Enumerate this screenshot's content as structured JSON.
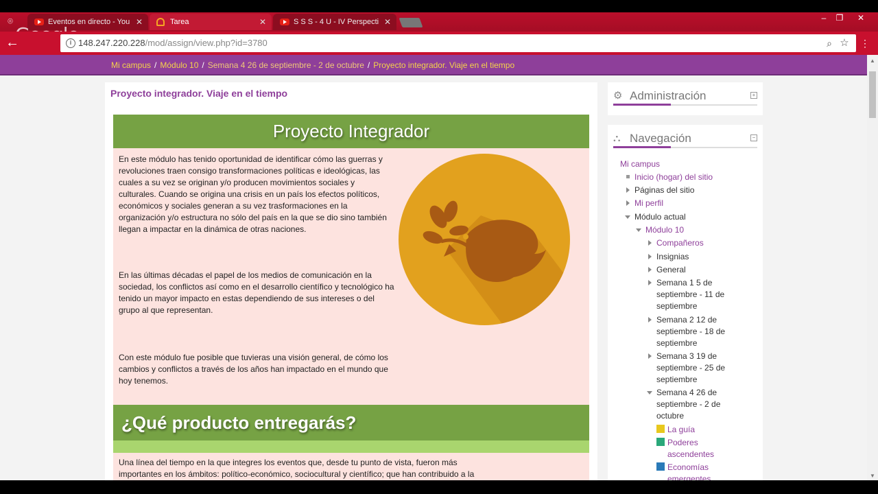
{
  "browser": {
    "tabs": [
      {
        "title": "Eventos en directo - You",
        "active": false,
        "icon": "youtube-icon"
      },
      {
        "title": "Tarea",
        "active": true,
        "icon": "moodle-icon"
      },
      {
        "title": "S S S - 4 U - IV Perspecti",
        "active": false,
        "icon": "youtube-icon"
      }
    ],
    "close_glyph": "✕",
    "watermark": "Google",
    "url_host": "148.247.220.228",
    "url_path": "/mod/assign/view.php?id=3780",
    "window_buttons": {
      "minimize": "‒",
      "restore": "❐",
      "close": "✕"
    }
  },
  "breadcrumb": [
    "Mi campus",
    "Módulo 10",
    "Semana 4 26 de septiembre - 2 de octubre",
    "Proyecto integrador. Viaje en el tiempo"
  ],
  "breadcrumb_separator": "/",
  "main": {
    "title": "Proyecto integrador. Viaje en el tiempo",
    "banner_title": "Proyecto Integrador",
    "paragraphs": [
      "En este módulo has tenido oportunidad de identificar cómo las guerras y revoluciones traen consigo transformaciones políticas e ideológicas, las cuales a su vez se originan y/o producen movimientos sociales y culturales. Cuando se origina una crisis en un país los efectos políticos, económicos y sociales generan a su vez trasformaciones en la organización y/o estructura no sólo del país en la que se dio sino también llegan a impactar en la dinámica de otras naciones.",
      "En las últimas décadas el papel de los medios de comunicación en la sociedad, los conflictos así como en el desarrollo científico y tecnológico ha tenido un mayor impacto en estas dependiendo de sus intereses o del grupo al que representan.",
      "Con este módulo fue posible que tuvieras una visión general, de cómo los cambios y conflictos a través de los años han impactado en el mundo que hoy tenemos."
    ],
    "section_title": "¿Qué producto entregarás?",
    "section_text": "Una línea del tiempo en la que integres los eventos que, desde tu punto de vista, fueron más importantes en los ámbitos: político-económico, sociocultural y científico; que han contribuido a la",
    "illustration": "dove-with-olive-branch-icon"
  },
  "admin_block": {
    "title": "Administración",
    "icon": "gears-icon",
    "control": "+"
  },
  "nav_block": {
    "title": "Navegación",
    "icon": "sitemap-icon",
    "control": "−",
    "items": [
      {
        "label": "Mi campus",
        "marker": "none",
        "style": "link"
      },
      {
        "label": "Inicio (hogar) del sitio",
        "marker": "bullet",
        "style": "link"
      },
      {
        "label": "Páginas del sitio",
        "marker": "right",
        "style": "black"
      },
      {
        "label": "Mi perfil",
        "marker": "right",
        "style": "link"
      },
      {
        "label": "Módulo actual",
        "marker": "down",
        "style": "black"
      },
      {
        "label": "Módulo 10",
        "marker": "down",
        "style": "link"
      },
      {
        "label": "Compañeros",
        "marker": "right",
        "style": "link"
      },
      {
        "label": "Insignias",
        "marker": "right",
        "style": "black"
      },
      {
        "label": "General",
        "marker": "right",
        "style": "black"
      },
      {
        "label": "Semana 1 5 de septiembre - 11 de septiembre",
        "marker": "right",
        "style": "black"
      },
      {
        "label": "Semana 2 12 de septiembre - 18 de septiembre",
        "marker": "right",
        "style": "black"
      },
      {
        "label": "Semana 3 19 de septiembre - 25 de septiembre",
        "marker": "right",
        "style": "black"
      },
      {
        "label": "Semana 4 26 de septiembre - 2 de octubre",
        "marker": "down",
        "style": "black"
      },
      {
        "label": "La guía",
        "marker": "icon",
        "style": "link",
        "icon_color": "#e8c81e"
      },
      {
        "label": "Poderes ascendentes",
        "marker": "icon",
        "style": "link",
        "icon_color": "#2aa87a"
      },
      {
        "label": "Economías emergentes",
        "marker": "icon",
        "style": "link",
        "icon_color": "#2a7ab8"
      }
    ]
  },
  "colors": {
    "brand_purple": "#8e3f9a",
    "chrome_red": "#c8102e",
    "banner_green": "#76a244",
    "content_pink": "#fde3df",
    "circle_gold": "#e2a11e",
    "bird_brown": "#a85a14"
  }
}
